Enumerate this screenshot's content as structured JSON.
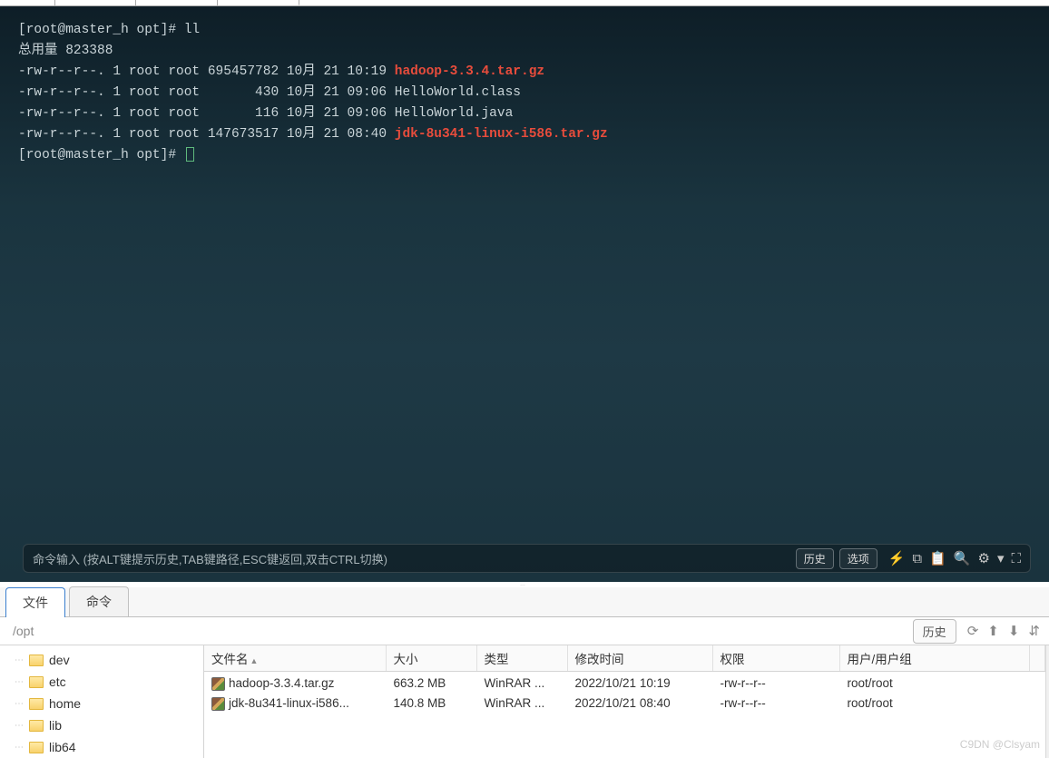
{
  "terminal": {
    "prompt1": "[root@master_h opt]# ll",
    "total_line": "总用量 823388",
    "rows": [
      {
        "perm": "-rw-r--r--. 1 root root 695457782 10月 21 10:19 ",
        "name": "hadoop-3.3.4.tar.gz",
        "red": true
      },
      {
        "perm": "-rw-r--r--. 1 root root       430 10月 21 09:06 ",
        "name": "HelloWorld.class",
        "red": false
      },
      {
        "perm": "-rw-r--r--. 1 root root       116 10月 21 09:06 ",
        "name": "HelloWorld.java",
        "red": false
      },
      {
        "perm": "-rw-r--r--. 1 root root 147673517 10月 21 08:40 ",
        "name": "jdk-8u341-linux-i586.tar.gz",
        "red": true
      }
    ],
    "prompt2": "[root@master_h opt]# "
  },
  "cmdbar": {
    "placeholder": "命令输入 (按ALT键提示历史,TAB键路径,ESC键返回,双击CTRL切换)",
    "history_btn": "历史",
    "options_btn": "选项"
  },
  "bottom_tabs": {
    "file": "文件",
    "cmd": "命令"
  },
  "pathbar": {
    "path": "/opt",
    "history": "历史"
  },
  "tree": [
    "dev",
    "etc",
    "home",
    "lib",
    "lib64"
  ],
  "columns": {
    "name": "文件名",
    "size": "大小",
    "type": "类型",
    "mtime": "修改时间",
    "perm": "权限",
    "owner": "用户/用户组"
  },
  "files": [
    {
      "name": "hadoop-3.3.4.tar.gz",
      "size": "663.2 MB",
      "type": "WinRAR ...",
      "mtime": "2022/10/21 10:19",
      "perm": "-rw-r--r--",
      "owner": "root/root"
    },
    {
      "name": "jdk-8u341-linux-i586...",
      "size": "140.8 MB",
      "type": "WinRAR ...",
      "mtime": "2022/10/21 08:40",
      "perm": "-rw-r--r--",
      "owner": "root/root"
    }
  ],
  "watermark": "C9DN @Clsyam"
}
